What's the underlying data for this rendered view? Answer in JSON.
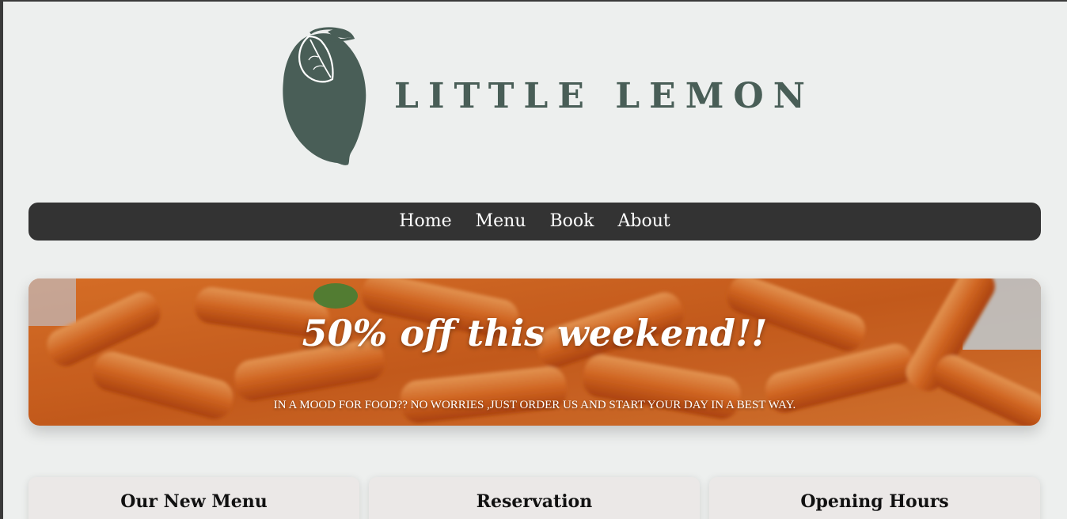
{
  "brand": {
    "name": "LITTLE LEMON",
    "color": "#495e57"
  },
  "nav": {
    "items": [
      {
        "label": "Home"
      },
      {
        "label": "Menu"
      },
      {
        "label": "Book"
      },
      {
        "label": "About"
      }
    ],
    "background": "#333333"
  },
  "hero": {
    "title": "50% off this weekend!!",
    "subtitle": "IN A MOOD FOR FOOD?? NO WORRIES ,JUST ORDER US AND START YOUR DAY IN A BEST WAY.",
    "image_icon": "pasta-image"
  },
  "cards": [
    {
      "title": "Our New Menu"
    },
    {
      "title": "Reservation"
    },
    {
      "title": "Opening Hours"
    }
  ]
}
